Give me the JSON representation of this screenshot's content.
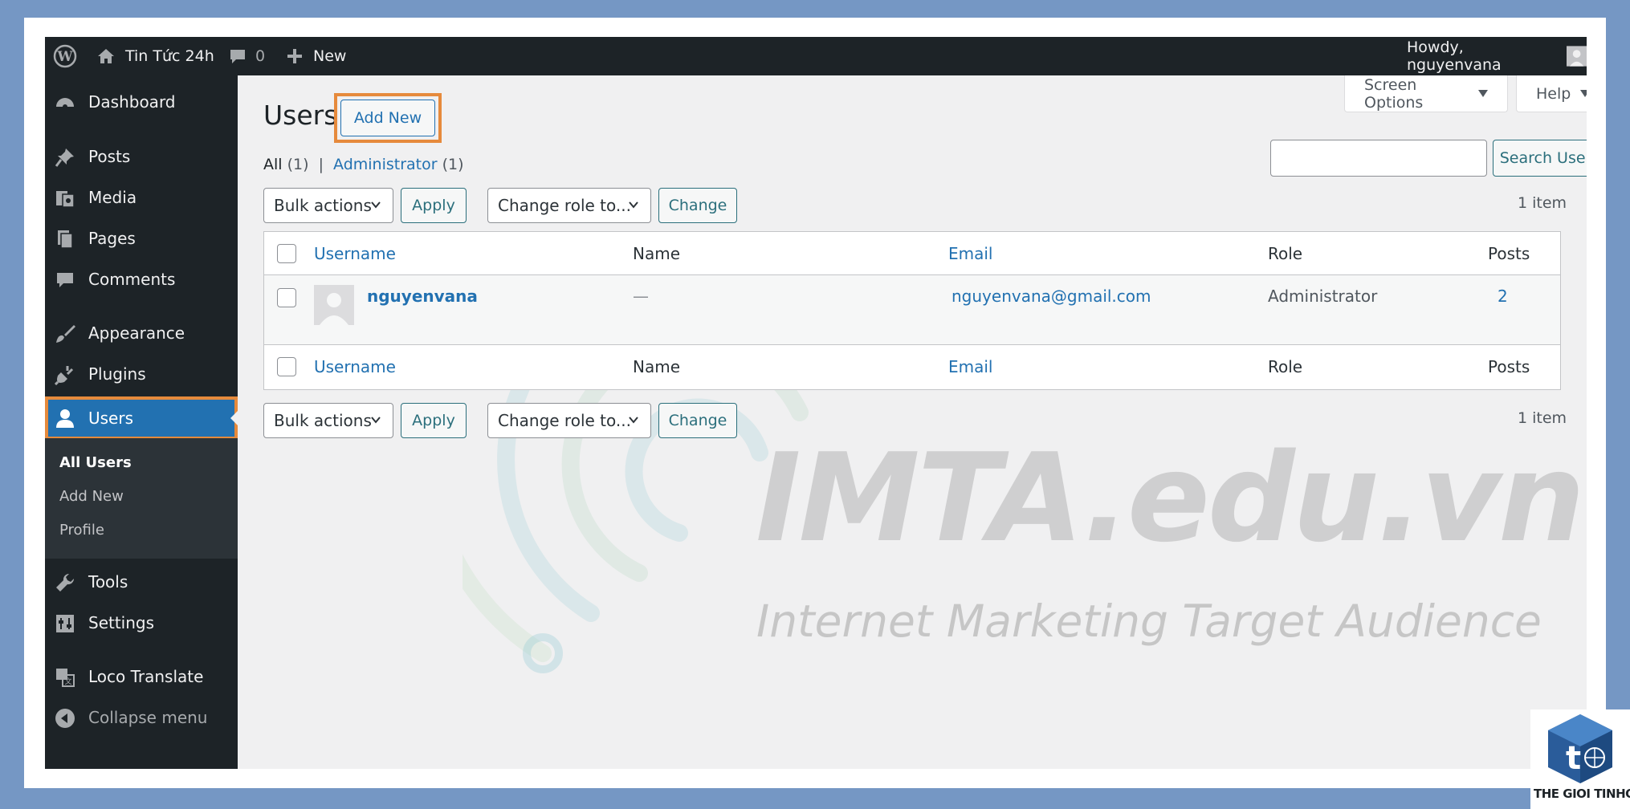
{
  "admin_bar": {
    "site_name": "Tin Tức 24h",
    "comments_count": "0",
    "new_label": "New",
    "greeting": "Howdy, nguyenvana"
  },
  "sidebar": {
    "items": [
      {
        "label": "Dashboard",
        "icon": "dashboard-icon"
      },
      {
        "label": "Posts",
        "icon": "pin-icon"
      },
      {
        "label": "Media",
        "icon": "media-icon"
      },
      {
        "label": "Pages",
        "icon": "pages-icon"
      },
      {
        "label": "Comments",
        "icon": "comment-icon"
      },
      {
        "label": "Appearance",
        "icon": "brush-icon"
      },
      {
        "label": "Plugins",
        "icon": "plug-icon"
      },
      {
        "label": "Users",
        "icon": "user-icon"
      },
      {
        "label": "Tools",
        "icon": "wrench-icon"
      },
      {
        "label": "Settings",
        "icon": "settings-icon"
      },
      {
        "label": "Loco Translate",
        "icon": "translate-icon"
      },
      {
        "label": "Collapse menu",
        "icon": "collapse-icon"
      }
    ],
    "submenu": [
      "All Users",
      "Add New",
      "Profile"
    ]
  },
  "page": {
    "title": "Users",
    "add_new": "Add New",
    "screen_options": "Screen Options",
    "help": "Help",
    "filter_all": "All",
    "filter_all_count": "(1)",
    "filter_sep": "|",
    "filter_admin": "Administrator",
    "filter_admin_count": "(1)",
    "search_button": "Search Users",
    "bulk_actions": "Bulk actions",
    "apply": "Apply",
    "change_role": "Change role to...",
    "change": "Change",
    "item_count": "1 item"
  },
  "table": {
    "columns": [
      "Username",
      "Name",
      "Email",
      "Role",
      "Posts"
    ],
    "rows": [
      {
        "username": "nguyenvana",
        "name": "—",
        "email": "nguyenvana@gmail.com",
        "role": "Administrator",
        "posts": "2"
      }
    ]
  },
  "watermark": {
    "title": "IMTA.edu.vn",
    "subtitle": "Internet Marketing Target Audience"
  },
  "corner_logo": {
    "text": "THE GIOI TINHOC"
  },
  "colors": {
    "accent": "#2271b1",
    "highlight": "#e68a3c",
    "adminbar": "#1d2327"
  }
}
